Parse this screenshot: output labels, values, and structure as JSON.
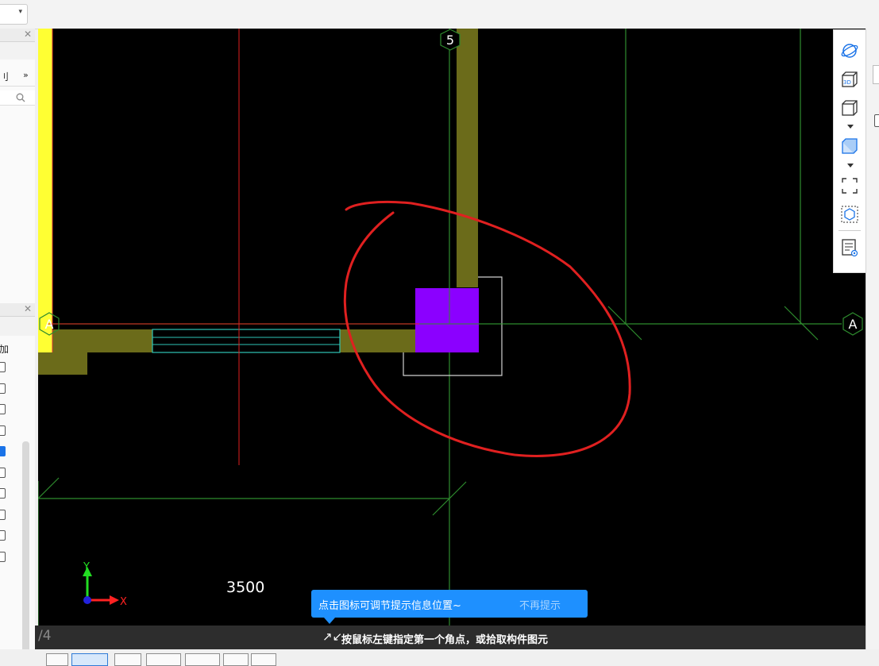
{
  "topbar": {
    "combo_arrow": "▾"
  },
  "left_panel": {
    "header1_close": "✕",
    "header2_close": "✕",
    "label_top": "刂",
    "expand_symbol": "»",
    "search_icon": "search-icon",
    "label_add": "加",
    "checkboxes": [
      false,
      false,
      false,
      false,
      true,
      false,
      false,
      false,
      false,
      false
    ]
  },
  "canvas": {
    "axis_label_5": "5",
    "axis_label_A_left": "A",
    "axis_label_A_right": "A",
    "dimension_text": "3500",
    "ucs_y": "Y",
    "ucs_x": "X"
  },
  "tooltip": {
    "message": "点击图标可调节提示信息位置~",
    "dismiss": "不再提示"
  },
  "status": {
    "page": "/4",
    "prompt": "按鼠标左键指定第一个角点，或拾取构件图元",
    "prompt_icon": "collapse-arrows-icon"
  },
  "view_toolbar": {
    "items": [
      "orbit-icon",
      "3d-view-icon",
      "cube-view-icon",
      "cube-shaded-icon",
      "fit-frame-icon",
      "box-select-icon",
      "display-settings-icon"
    ],
    "label_3d": "3D"
  },
  "colors": {
    "canvas_bg": "#000000",
    "wall_fill": "#6b6b1a",
    "column_fill": "#8b00ff",
    "grid_green": "#2e8b2e",
    "axis_red": "#e02020",
    "annotation_red": "#e02020",
    "yellow_wall": "#ffff33",
    "tooltip_blue": "#1e90ff"
  }
}
